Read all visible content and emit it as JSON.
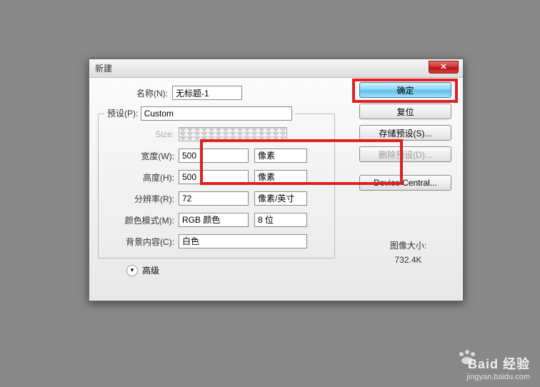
{
  "dialog": {
    "title": "新建",
    "name_label": "名称(N):",
    "name_value": "无标题-1",
    "preset_label": "预设(P):",
    "preset_value": "Custom",
    "size_label": "Size:",
    "width_label": "宽度(W):",
    "width_value": "500",
    "width_unit": "像素",
    "height_label": "高度(H):",
    "height_value": "500",
    "height_unit": "像素",
    "resolution_label": "分辨率(R):",
    "resolution_value": "72",
    "resolution_unit": "像素/英寸",
    "colormode_label": "颜色模式(M):",
    "colormode_value": "RGB 颜色",
    "colordepth_value": "8 位",
    "background_label": "背景内容(C):",
    "background_value": "白色",
    "advanced_label": "高级"
  },
  "buttons": {
    "ok": "确定",
    "reset": "复位",
    "save_preset": "存储预设(S)...",
    "delete_preset": "删除预设(D)...",
    "device_central": "Device Central..."
  },
  "image_size": {
    "label": "图像大小:",
    "value": "732.4K"
  },
  "watermark": {
    "brand": "Baid 经验",
    "sub": "jingyan.baidu.com"
  }
}
